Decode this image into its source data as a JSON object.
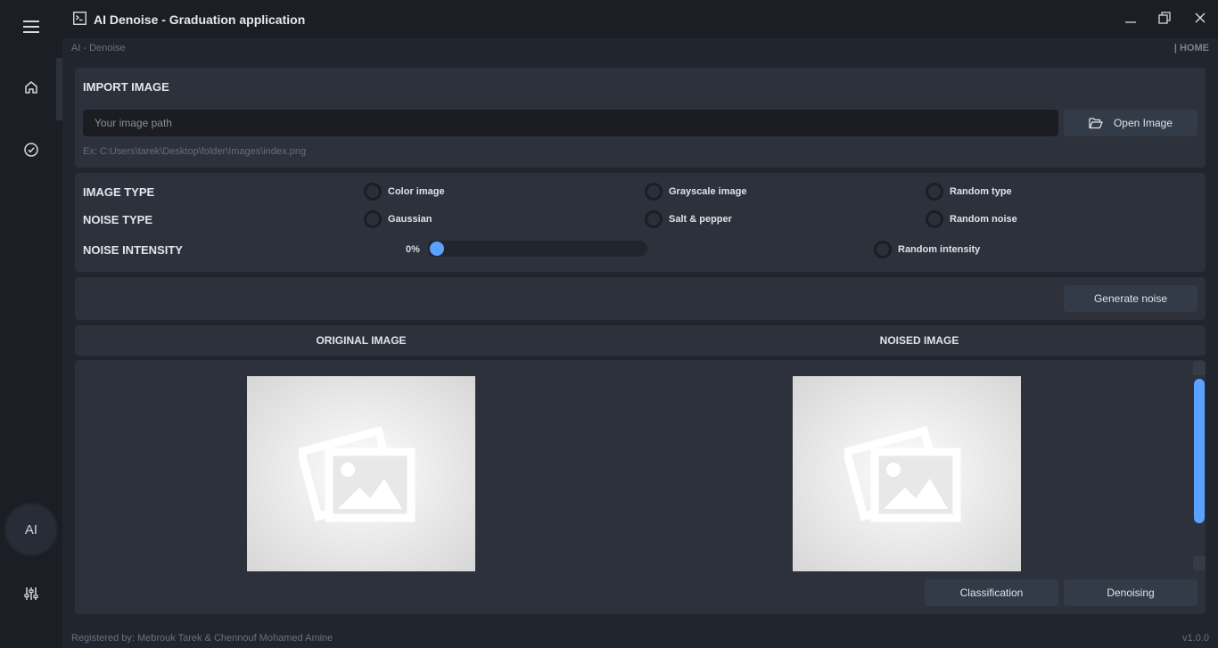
{
  "window": {
    "title": "AI Denoise - Graduation application"
  },
  "breadcrumb": {
    "left": "AI - Denoise",
    "right": "| HOME"
  },
  "sidebar": {
    "ai_label": "AI"
  },
  "import": {
    "title": "IMPORT IMAGE",
    "path_value": "",
    "path_placeholder": "Your image path",
    "open_button": "Open Image",
    "hint": "Ex: C:Users\\tarek\\Desktop\\folder\\Images\\index.png"
  },
  "options": {
    "image_type_label": "IMAGE TYPE",
    "image_types": [
      "Color image",
      "Grayscale image",
      "Random type"
    ],
    "noise_type_label": "NOISE TYPE",
    "noise_types": [
      "Gaussian",
      "Salt & pepper",
      "Random noise"
    ],
    "intensity_label": "NOISE INTENSITY",
    "intensity_value": "0%",
    "intensity_fraction": 0,
    "random_intensity": "Random intensity"
  },
  "actions": {
    "generate_noise": "Generate noise",
    "classification": "Classification",
    "denoising": "Denoising"
  },
  "images": {
    "original_label": "ORIGINAL IMAGE",
    "noised_label": "NOISED IMAGE"
  },
  "footer": {
    "credits": "Registered by: Mebrouk Tarek & Chennouf Mohamed Amine",
    "version": "v1.0.0"
  },
  "colors": {
    "accent": "#5aa2ff",
    "background": "#21252d",
    "panel": "#2c313c",
    "sidebar": "#1b1e24"
  }
}
